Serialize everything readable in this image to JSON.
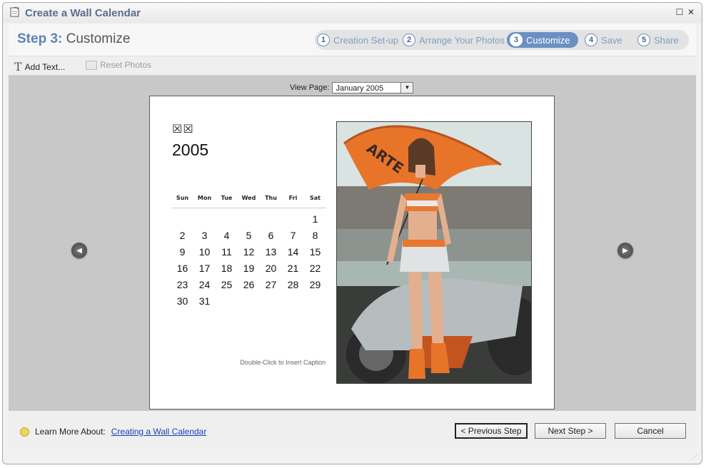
{
  "window": {
    "title": "Create a Wall Calendar"
  },
  "step_header": {
    "number": "Step 3:",
    "name": "Customize"
  },
  "steps": [
    {
      "num": "1",
      "label": "Creation Set-up"
    },
    {
      "num": "2",
      "label": "Arrange Your Photos"
    },
    {
      "num": "3",
      "label": "Customize"
    },
    {
      "num": "4",
      "label": "Save"
    },
    {
      "num": "5",
      "label": "Share"
    }
  ],
  "toolbar": {
    "add_text": "Add Text...",
    "reset_photos": "Reset Photos"
  },
  "view_page": {
    "label": "View Page:",
    "selected": "January 2005"
  },
  "calendar": {
    "month": "☒☒",
    "year": "2005",
    "weekdays": [
      "Sun",
      "Mon",
      "Tue",
      "Wed",
      "Thu",
      "Fri",
      "Sat"
    ],
    "days": [
      "",
      "",
      "",
      "",
      "",
      "",
      "1",
      "2",
      "3",
      "4",
      "5",
      "6",
      "7",
      "8",
      "9",
      "10",
      "11",
      "12",
      "13",
      "14",
      "15",
      "16",
      "17",
      "18",
      "19",
      "20",
      "21",
      "22",
      "23",
      "24",
      "25",
      "26",
      "27",
      "28",
      "29",
      "30",
      "31",
      "",
      "",
      "",
      "",
      ""
    ],
    "caption": "Double-Click to Insert Caption"
  },
  "photo": {
    "umbrella_text": "ARTE"
  },
  "footer": {
    "learn_label": "Learn More About:",
    "learn_link": "Creating a Wall Calendar",
    "prev": "< Previous Step",
    "next": "Next Step >",
    "cancel": "Cancel"
  },
  "colors": {
    "accent": "#6b90c3",
    "step_text": "#7e9ec4",
    "link": "#1a3fb8"
  },
  "icons": {
    "add_text": "text-T-icon",
    "reset": "reset-photos-icon",
    "prev_page": "arrow-left-icon",
    "next_page": "arrow-right-icon",
    "learn": "lightbulb-icon"
  }
}
